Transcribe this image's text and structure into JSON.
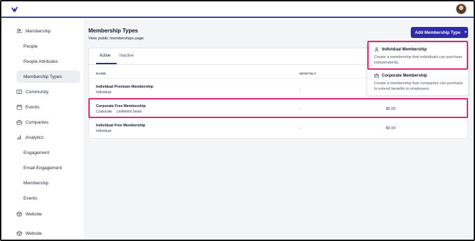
{
  "sidebar": {
    "items": [
      {
        "label": "Membership",
        "icon": "users-icon"
      },
      {
        "label": "People"
      },
      {
        "label": "People Attributes"
      },
      {
        "label": "Membership Types"
      },
      {
        "label": "Community",
        "icon": "book-icon"
      },
      {
        "label": "Events",
        "icon": "calendar-icon"
      },
      {
        "label": "Companies",
        "icon": "briefcase-icon"
      },
      {
        "label": "Analytics",
        "icon": "bar-chart-icon"
      },
      {
        "label": "Engagement"
      },
      {
        "label": "Email Engagement"
      },
      {
        "label": "Membership"
      },
      {
        "label": "Events"
      },
      {
        "label": "Website",
        "icon": "cube-icon"
      },
      {
        "label": "Website",
        "icon": "cube-icon"
      }
    ]
  },
  "header": {
    "title": "Membership Types",
    "link": "View public memberships page",
    "add_button": "Add Membership Type"
  },
  "tabs": [
    "Active",
    "Inactive"
  ],
  "table": {
    "columns": [
      "NAME",
      "MONTHLY"
    ],
    "rows": [
      {
        "name": "Individual Premium Membership",
        "type": "Individual",
        "tag": "",
        "monthly": "-",
        "yearly": ""
      },
      {
        "name": "Corporate Free Membership",
        "type": "Corporate",
        "tag": "Unlimited Seats",
        "monthly": "-",
        "yearly": "$0.00"
      },
      {
        "name": "Individual Free Membership",
        "type": "Individual",
        "tag": "",
        "monthly": "-",
        "yearly": "$0.00"
      }
    ]
  },
  "dropdown": {
    "items": [
      {
        "title": "Individual Membership",
        "icon": "user-icon",
        "desc": "Create a membership that individuals can purchase independently."
      },
      {
        "title": "Corporate Membership",
        "icon": "briefcase-icon",
        "desc": "Create a membership that companies can purchase to extend benefits to employees."
      }
    ]
  },
  "colors": {
    "accent": "#2e2aa8",
    "highlight": "#e0266e",
    "background": "#f4f5f7"
  }
}
